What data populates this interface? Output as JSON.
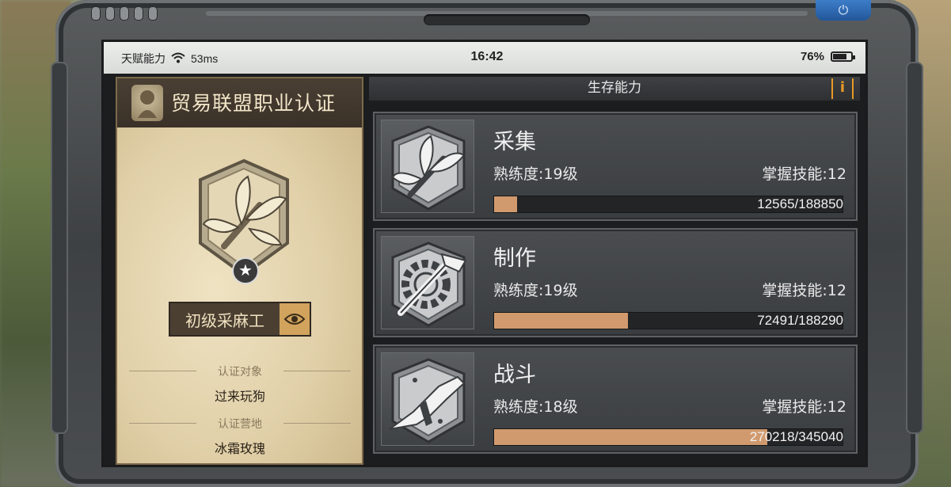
{
  "status_bar": {
    "carrier": "天赋能力",
    "ping": "53ms",
    "time": "16:42",
    "battery_percent": "76%",
    "battery_level": 0.76
  },
  "certificate": {
    "title": "贸易联盟职业认证",
    "rank_title": "初级采麻工",
    "field1_label": "认证对象",
    "field1_value": "过来玩狗",
    "field2_label": "认证营地",
    "field2_value": "冰霜玫瑰",
    "stars": 1
  },
  "skills_panel": {
    "title": "生存能力",
    "info_label": "i"
  },
  "skills": [
    {
      "name": "采集",
      "level": "熟练度:19级",
      "mastered": "掌握技能:12",
      "xp_text": "12565/188850",
      "xp_current": 12565,
      "xp_max": 188850,
      "icon": "leaf-bundle-icon"
    },
    {
      "name": "制作",
      "level": "熟练度:19级",
      "mastered": "掌握技能:12",
      "xp_text": "72491/188290",
      "xp_current": 72491,
      "xp_max": 188290,
      "icon": "gear-hammer-icon"
    },
    {
      "name": "战斗",
      "level": "熟练度:18级",
      "mastered": "掌握技能:12",
      "xp_text": "270218/345040",
      "xp_current": 270218,
      "xp_max": 345040,
      "icon": "submachine-gun-icon"
    }
  ],
  "colors": {
    "accent": "#e89a28",
    "xp_fill": "#d19a6e",
    "device_button": "#2f6bb5"
  }
}
